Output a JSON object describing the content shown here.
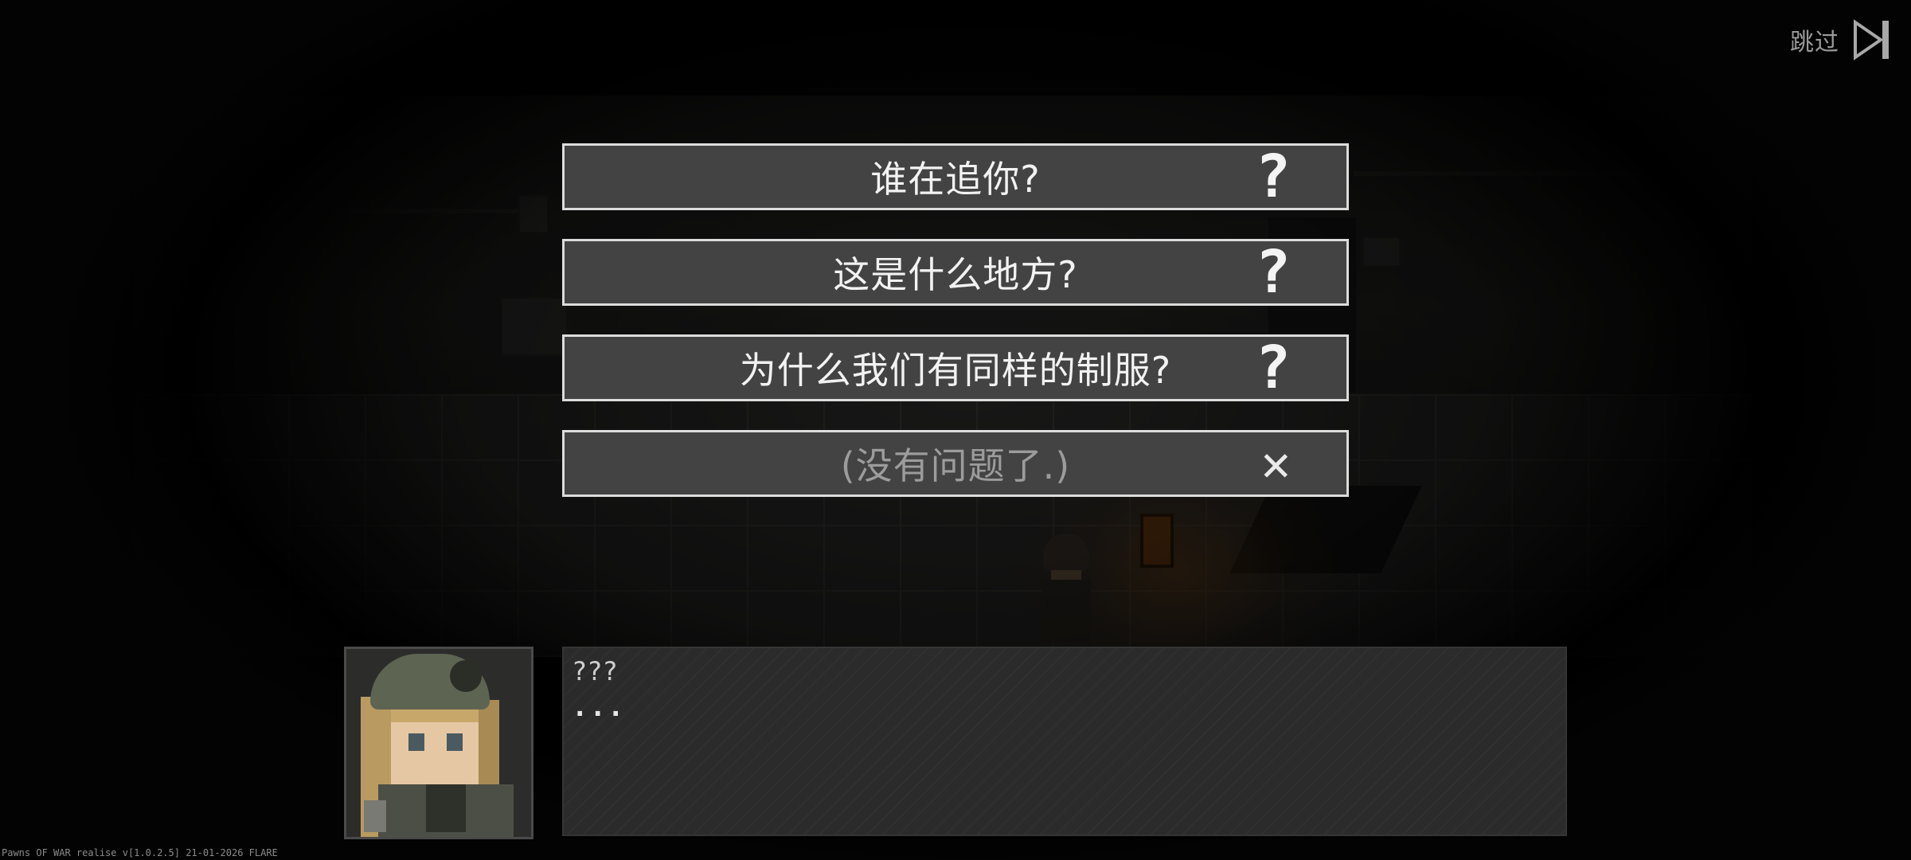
{
  "skip": {
    "label": "跳过",
    "icon": "skip-forward-icon"
  },
  "choices": [
    {
      "text": "谁在追你?",
      "icon": "question-mark-icon",
      "icon_glyph": "?"
    },
    {
      "text": "这是什么地方?",
      "icon": "question-mark-icon",
      "icon_glyph": "?"
    },
    {
      "text": "为什么我们有同样的制服?",
      "icon": "question-mark-icon",
      "icon_glyph": "?"
    },
    {
      "text": "(没有问题了.)",
      "icon": "close-icon",
      "icon_glyph": "✕"
    }
  ],
  "dialogue": {
    "speaker": "???",
    "text": "..."
  },
  "version": "Pawns OF WAR realise v[1.0.2.5] 21-01-2026 FLARE",
  "colors": {
    "choice_bg": "#434343",
    "choice_border": "#dcdcdc",
    "dialogue_bg": "#2b2b2b"
  }
}
